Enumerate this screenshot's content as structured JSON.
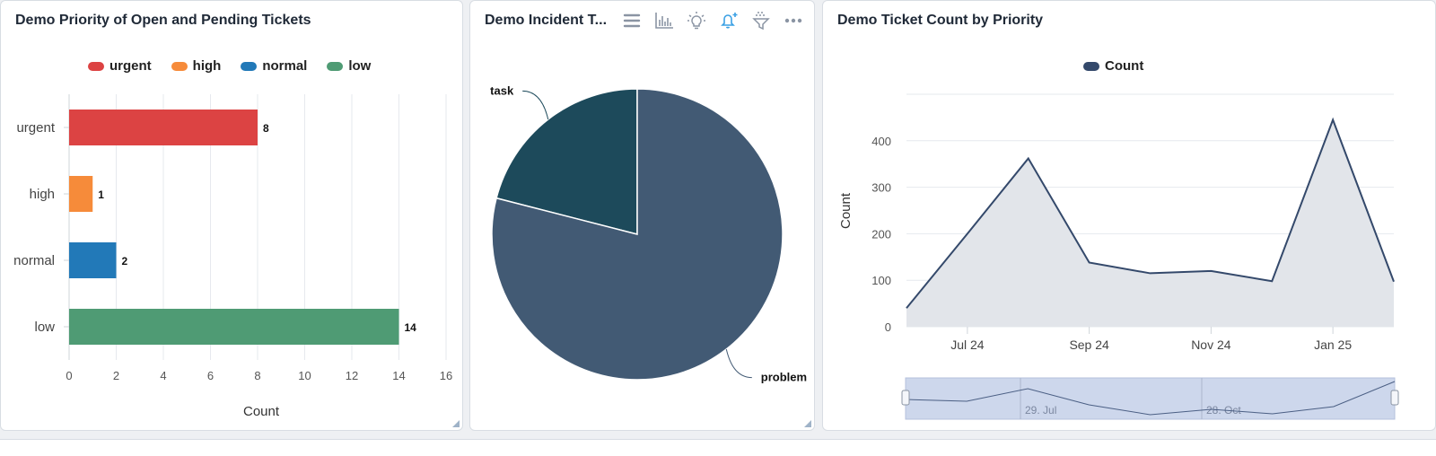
{
  "panels": {
    "priority": {
      "title": "Demo Priority of Open and Pending Tickets"
    },
    "incident": {
      "title": "Demo Incident T..."
    },
    "count": {
      "title": "Demo Ticket Count by Priority"
    }
  },
  "icons": {
    "incident_toolbar": [
      "list-icon",
      "bar-chart-icon",
      "lightbulb-icon",
      "bell-plus-icon",
      "filter-icon",
      "more-icon"
    ]
  },
  "colors": {
    "urgent": "#dc4343",
    "high": "#f68b3a",
    "normal": "#2279b8",
    "low": "#4f9b74",
    "task": "#1d4a5b",
    "problem": "#425a74",
    "line": "#34496b",
    "area": "#e2e5ea",
    "navigator": "#cdd7ec",
    "bell_active": "#3aa0e4"
  },
  "chart_data": [
    {
      "type": "bar",
      "orientation": "horizontal",
      "title": "Demo Priority of Open and Pending Tickets",
      "categories": [
        "urgent",
        "high",
        "normal",
        "low"
      ],
      "values": [
        8,
        1,
        2,
        14
      ],
      "legend": [
        "urgent",
        "high",
        "normal",
        "low"
      ],
      "legend_position": "top",
      "xlabel": "Count",
      "xlim": [
        0,
        16
      ],
      "xticks": [
        "0",
        "2",
        "4",
        "6",
        "8",
        "10",
        "12",
        "14",
        "16"
      ],
      "grid": true
    },
    {
      "type": "pie",
      "title": "Demo Incident T...",
      "labels": [
        "task",
        "problem"
      ],
      "values": [
        21,
        79
      ]
    },
    {
      "type": "area",
      "title": "Demo Ticket Count by Priority",
      "legend": [
        "Count"
      ],
      "legend_position": "top",
      "ylabel": "Count",
      "ylim": [
        0,
        500
      ],
      "yticks": [
        "0",
        "100",
        "200",
        "300",
        "400"
      ],
      "xticks": [
        "Jul 24",
        "Sep 24",
        "Nov 24",
        "Jan 25"
      ],
      "x": [
        "2024-06",
        "2024-07",
        "2024-08",
        "2024-09",
        "2024-10",
        "2024-11",
        "2024-12",
        "2025-01",
        "2025-02"
      ],
      "series": [
        {
          "name": "Count",
          "values": [
            40,
            200,
            362,
            138,
            115,
            120,
            98,
            445,
            97
          ]
        }
      ],
      "navigator": {
        "labels": [
          "29. Jul",
          "28. Oct"
        ]
      },
      "grid": true
    }
  ]
}
